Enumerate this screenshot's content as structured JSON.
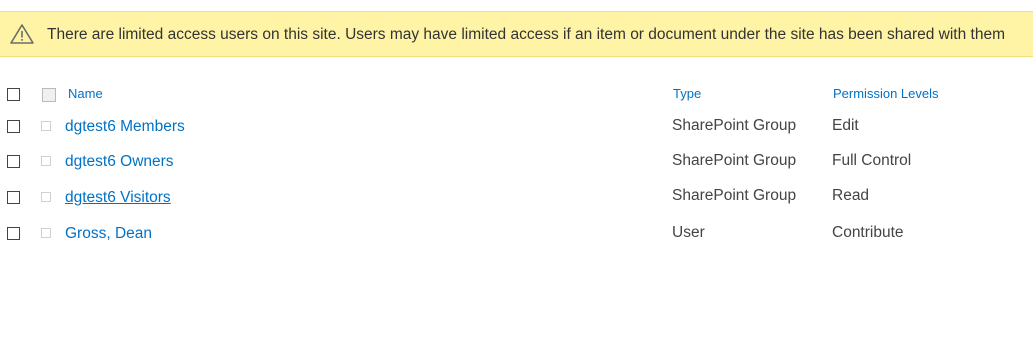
{
  "banner": {
    "icon": "warning-icon",
    "message": "There are limited access users on this site. Users may have limited access if an item or document under the site has been shared with them"
  },
  "table": {
    "columns": [
      "Name",
      "Type",
      "Permission Levels"
    ],
    "rows": [
      {
        "name": "dgtest6 Members",
        "type": "SharePoint Group",
        "permission": "Edit"
      },
      {
        "name": "dgtest6 Owners",
        "type": "SharePoint Group",
        "permission": "Full Control"
      },
      {
        "name": "dgtest6 Visitors",
        "type": "SharePoint Group",
        "permission": "Read"
      },
      {
        "name": "Gross, Dean",
        "type": "User",
        "permission": "Contribute"
      }
    ]
  },
  "colors": {
    "banner_bg": "#fff4a5",
    "link": "#0072c6",
    "text": "#444444"
  }
}
